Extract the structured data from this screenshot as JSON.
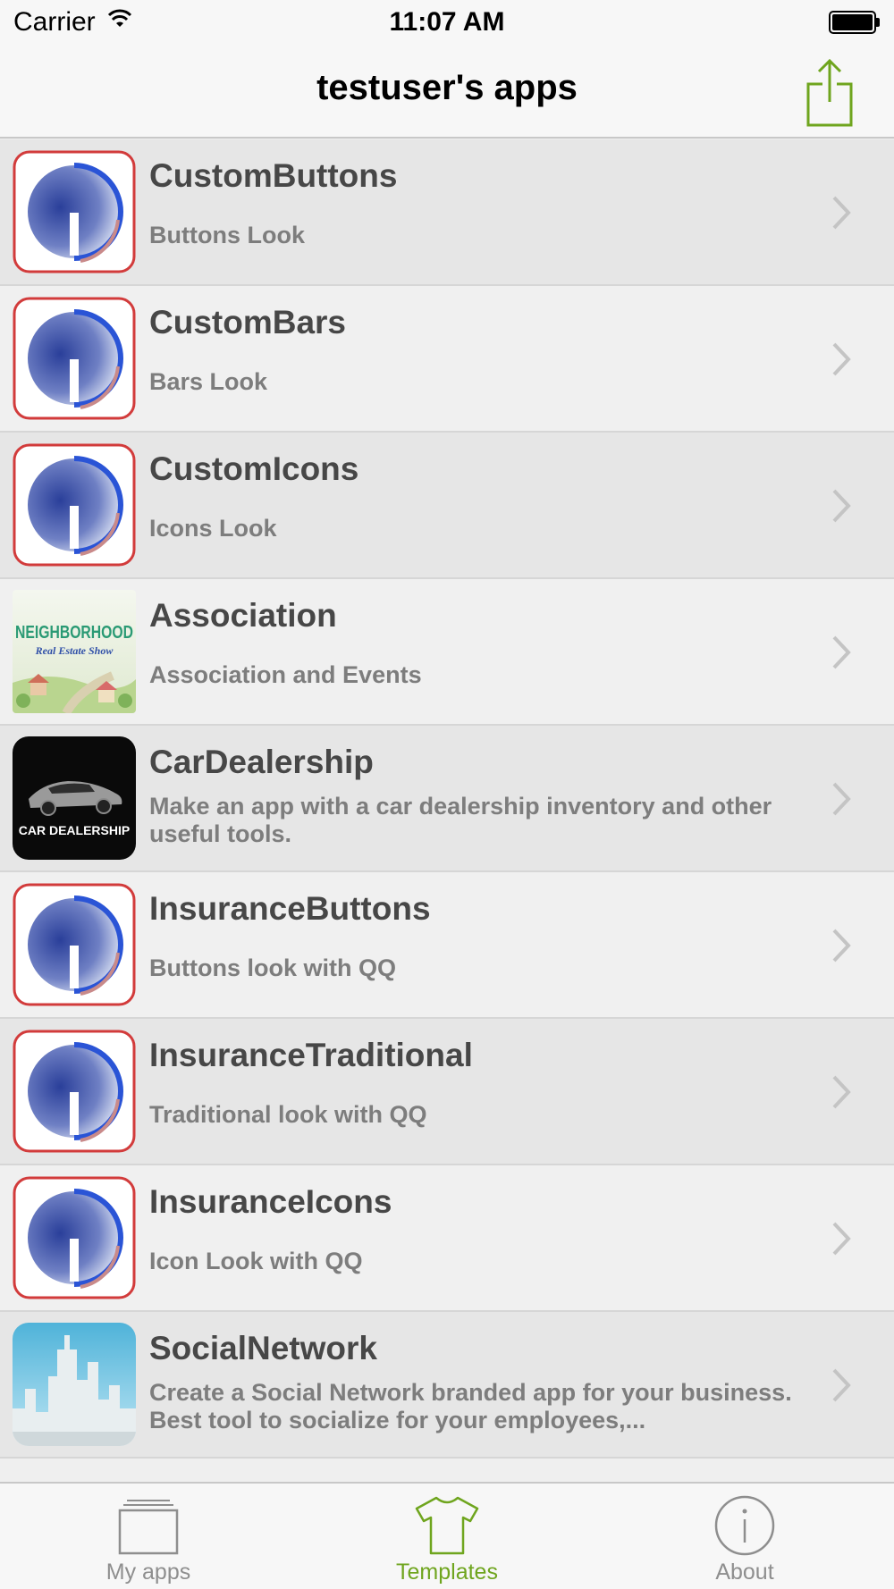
{
  "status_bar": {
    "carrier": "Carrier",
    "time": "11:07 AM"
  },
  "nav_bar": {
    "title": "testuser's apps",
    "share_icon": "share-icon"
  },
  "colors": {
    "accent": "#6fa51e",
    "title_text": "#474747",
    "subtitle_text": "#7d7d7d",
    "row_alt": "#e6e6e6",
    "row_base": "#f0f0f0"
  },
  "apps": [
    {
      "title": "CustomButtons",
      "subtitle": "Buttons Look",
      "icon": "logo-icon"
    },
    {
      "title": "CustomBars",
      "subtitle": "Bars Look",
      "icon": "logo-icon"
    },
    {
      "title": "CustomIcons",
      "subtitle": "Icons Look",
      "icon": "logo-icon"
    },
    {
      "title": "Association",
      "subtitle": "Association and Events",
      "icon": "neighborhood-icon",
      "thumb_text": [
        "NEIGHBORHOOD",
        "Real Estate Show"
      ]
    },
    {
      "title": "CarDealership",
      "subtitle": "Make an app with a car dealership inventory and other useful tools.",
      "icon": "car-dealership-icon",
      "thumb_text": [
        "CAR DEALERSHIP"
      ]
    },
    {
      "title": "InsuranceButtons",
      "subtitle": "Buttons look with QQ",
      "icon": "logo-icon"
    },
    {
      "title": "InsuranceTraditional",
      "subtitle": "Traditional look with QQ",
      "icon": "logo-icon"
    },
    {
      "title": "InsuranceIcons",
      "subtitle": "Icon Look with QQ",
      "icon": "logo-icon"
    },
    {
      "title": "SocialNetwork",
      "subtitle": "Create a Social Network branded app for your business. Best tool to socialize for your employees,...",
      "icon": "city-skyline-icon"
    }
  ],
  "tab_bar": {
    "tabs": [
      {
        "label": "My apps",
        "icon": "folder-stack-icon",
        "active": false
      },
      {
        "label": "Templates",
        "icon": "tshirt-icon",
        "active": true
      },
      {
        "label": "About",
        "icon": "info-icon",
        "active": false
      }
    ]
  }
}
